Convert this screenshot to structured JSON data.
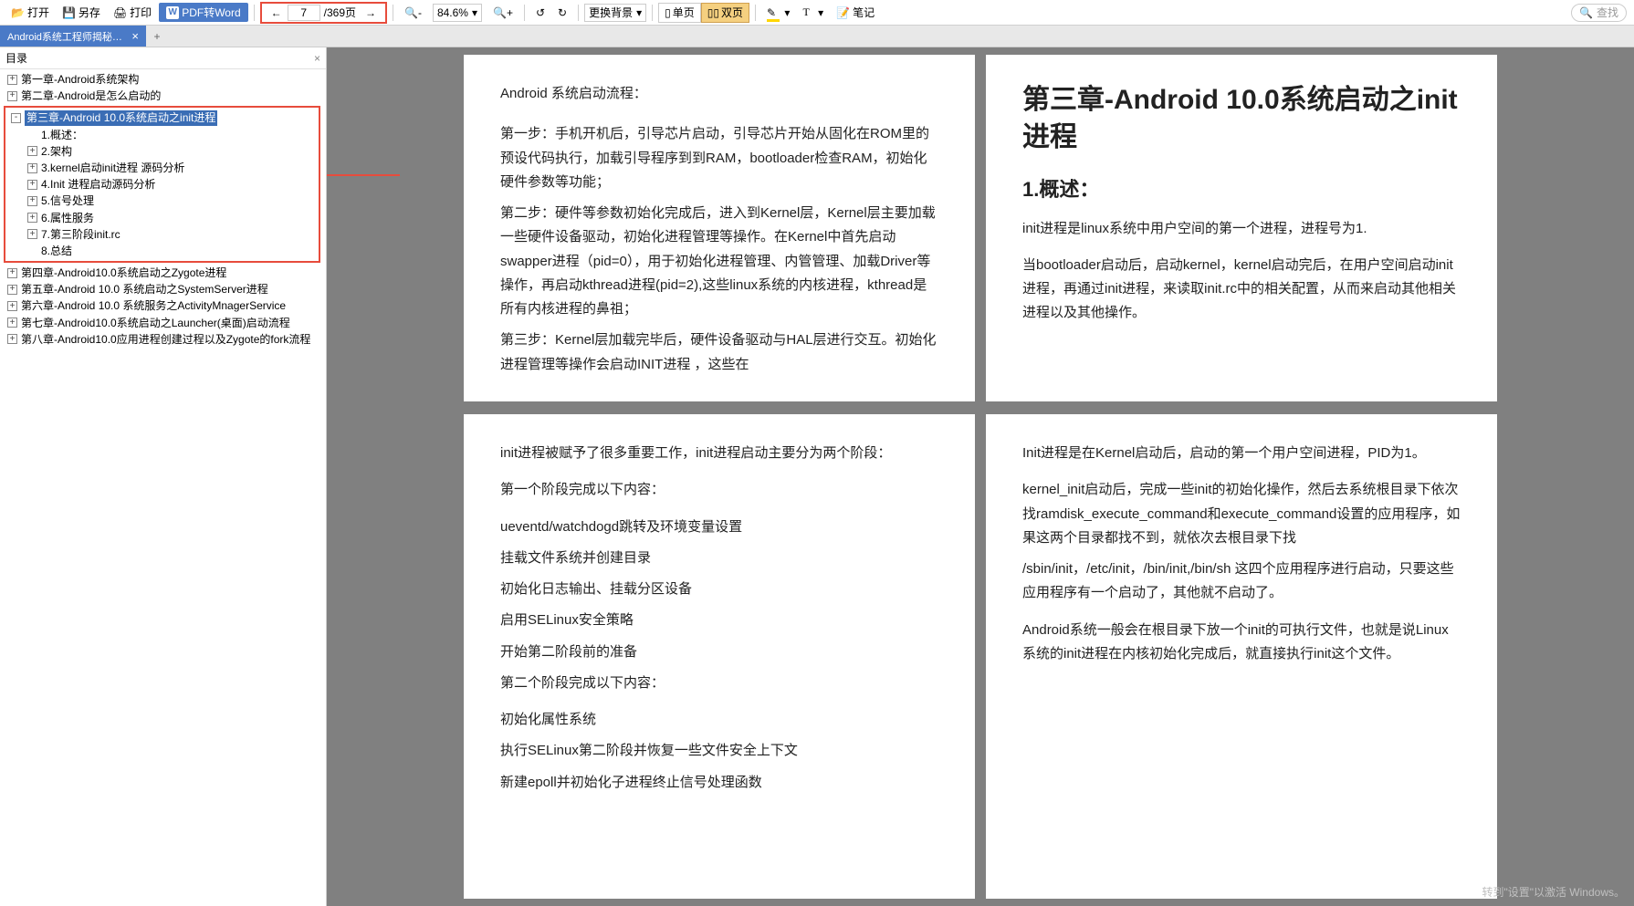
{
  "toolbar": {
    "open": "打开",
    "saveas": "另存",
    "print": "打印",
    "pdf2word": "PDF转Word",
    "page_current": "7",
    "page_total": "/369页",
    "zoom": "84.6%",
    "bg": "更换背景",
    "single": "单页",
    "double": "双页",
    "note": "笔记",
    "search_ph": "查找"
  },
  "tab": {
    "title": "Android系统工程师揭秘Androi"
  },
  "sidebar": {
    "title": "目录",
    "items": [
      {
        "exp": "+",
        "label": "第一章-Android系统架构",
        "lvl": 0
      },
      {
        "exp": "+",
        "label": "第二章-Android是怎么启动的",
        "lvl": 0
      }
    ],
    "selected": {
      "exp": "-",
      "label": "第三章-Android 10.0系统启动之init进程",
      "lvl": 0
    },
    "selected_children": [
      {
        "exp": "",
        "label": "1.概述：",
        "lvl": 1
      },
      {
        "exp": "+",
        "label": "2.架构",
        "lvl": 1
      },
      {
        "exp": "+",
        "label": "3.kernel启动init进程 源码分析",
        "lvl": 1
      },
      {
        "exp": "+",
        "label": "4.Init 进程启动源码分析",
        "lvl": 1
      },
      {
        "exp": "+",
        "label": "5.信号处理",
        "lvl": 1
      },
      {
        "exp": "+",
        "label": "6.属性服务",
        "lvl": 1
      },
      {
        "exp": "+",
        "label": "7.第三阶段init.rc",
        "lvl": 1
      },
      {
        "exp": "",
        "label": "8.总结",
        "lvl": 1
      }
    ],
    "rest": [
      {
        "exp": "+",
        "label": "第四章-Android10.0系统启动之Zygote进程",
        "lvl": 0
      },
      {
        "exp": "+",
        "label": "第五章-Android 10.0  系统启动之SystemServer进程",
        "lvl": 0
      },
      {
        "exp": "+",
        "label": "第六章-Android 10.0  系统服务之ActivityMnagerService",
        "lvl": 0
      },
      {
        "exp": "+",
        "label": "第七章-Android10.0系统启动之Launcher(桌面)启动流程",
        "lvl": 0
      },
      {
        "exp": "+",
        "label": "第八章-Android10.0应用进程创建过程以及Zygote的fork流程",
        "lvl": 0
      }
    ]
  },
  "pages": {
    "left_top": {
      "p1": "Android 系统启动流程：",
      "p2": "第一步：手机开机后，引导芯片启动，引导芯片开始从固化在ROM里的预设代码执行，加载引导程序到到RAM，bootloader检查RAM，初始化硬件参数等功能；",
      "p3": "第二步：硬件等参数初始化完成后，进入到Kernel层，Kernel层主要加载一些硬件设备驱动，初始化进程管理等操作。在Kernel中首先启动swapper进程（pid=0），用于初始化进程管理、内管管理、加载Driver等操作，再启动kthread进程(pid=2),这些linux系统的内核进程，kthread是所有内核进程的鼻祖；",
      "p4": "第三步：Kernel层加载完毕后，硬件设备驱动与HAL层进行交互。初始化进程管理等操作会启动INIT进程 ，这些在"
    },
    "left_bottom": {
      "p1": "init进程被赋予了很多重要工作，init进程启动主要分为两个阶段：",
      "p2": "第一个阶段完成以下内容：",
      "p3": "ueventd/watchdogd跳转及环境变量设置",
      "p4": "挂载文件系统并创建目录",
      "p5": "初始化日志输出、挂载分区设备",
      "p6": "启用SELinux安全策略",
      "p7": "开始第二阶段前的准备",
      "p8": "第二个阶段完成以下内容：",
      "p9": "初始化属性系统",
      "p10": "执行SELinux第二阶段并恢复一些文件安全上下文",
      "p11": "新建epoll并初始化子进程终止信号处理函数"
    },
    "right_top": {
      "h1": "第三章-Android 10.0系统启动之init进程",
      "h2": "1.概述：",
      "p1": "init进程是linux系统中用户空间的第一个进程，进程号为1.",
      "p2": "当bootloader启动后，启动kernel，kernel启动完后，在用户空间启动init进程，再通过init进程，来读取init.rc中的相关配置，从而来启动其他相关进程以及其他操作。"
    },
    "right_bottom": {
      "p1": "Init进程是在Kernel启动后，启动的第一个用户空间进程，PID为1。",
      "p2": "kernel_init启动后，完成一些init的初始化操作，然后去系统根目录下依次找ramdisk_execute_command和execute_command设置的应用程序，如果这两个目录都找不到，就依次去根目录下找",
      "p3": "/sbin/init，/etc/init，/bin/init,/bin/sh 这四个应用程序进行启动，只要这些应用程序有一个启动了，其他就不启动了。",
      "p4": "Android系统一般会在根目录下放一个init的可执行文件，也就是说Linux系统的init进程在内核初始化完成后，就直接执行init这个文件。"
    }
  },
  "watermark": {
    "l1": "转到\"设置\"以激活 Windows。"
  }
}
